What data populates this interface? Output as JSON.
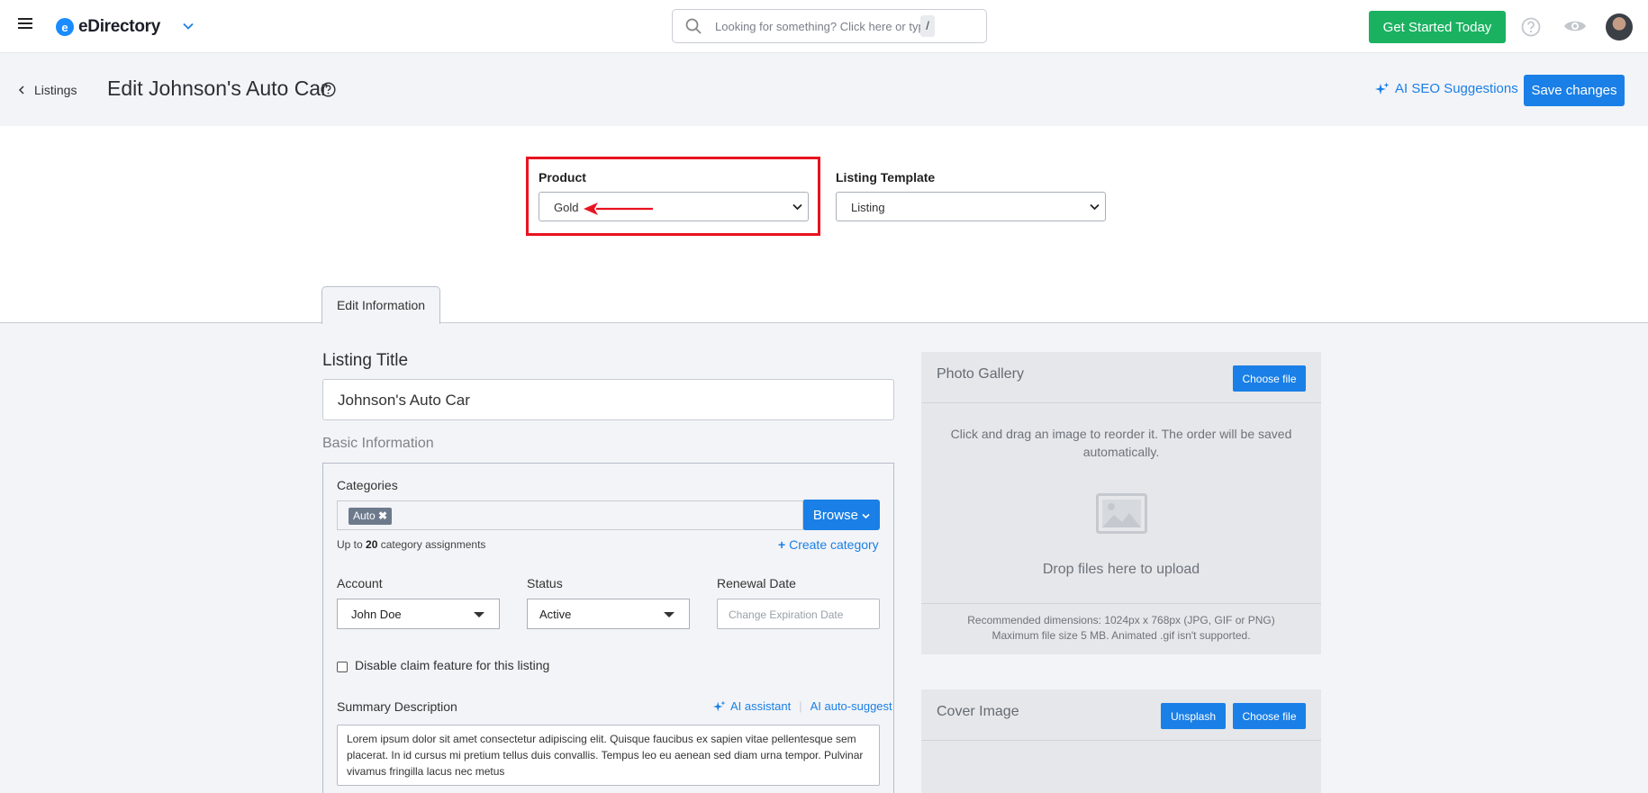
{
  "topbar": {
    "brand": "eDirectory",
    "search_placeholder": "Looking for something? Click here or type",
    "search_shortcut": "/",
    "get_started": "Get Started Today"
  },
  "header": {
    "back_label": "Listings",
    "page_title": "Edit Johnson's Auto Car",
    "ai_seo": "AI SEO Suggestions",
    "save": "Save changes"
  },
  "selects": {
    "product_label": "Product",
    "product_value": "Gold",
    "template_label": "Listing Template",
    "template_value": "Listing"
  },
  "tab": "Edit Information",
  "form": {
    "listing_title_heading": "Listing Title",
    "listing_title_value": "Johnson's Auto Car",
    "basic_info": "Basic Information",
    "categories_label": "Categories",
    "category_chip": "Auto",
    "browse": "Browse",
    "hint_prefix": "Up to ",
    "hint_count": "20",
    "hint_suffix": " category assignments",
    "create_category": "Create category",
    "account_label": "Account",
    "account_value": "John Doe",
    "status_label": "Status",
    "status_value": "Active",
    "renewal_label": "Renewal Date",
    "renewal_placeholder": "Change Expiration Date",
    "disable_claim": "Disable claim feature for this listing",
    "summary_label": "Summary Description",
    "ai_assistant": "AI assistant",
    "ai_autosuggest": "AI auto-suggest",
    "summary_text": "Lorem ipsum dolor sit amet consectetur adipiscing elit. Quisque faucibus ex sapien vitae pellentesque sem placerat. In id cursus mi pretium tellus duis convallis. Tempus leo eu aenean sed diam urna tempor. Pulvinar vivamus fringilla lacus nec metus"
  },
  "gallery": {
    "title": "Photo Gallery",
    "choose_file": "Choose file",
    "reorder_text": "Click and drag an image to reorder it. The order will be saved automatically.",
    "drop_text": "Drop files here to upload",
    "recommended": "Recommended dimensions: 1024px x 768px (JPG, GIF or PNG)",
    "max_size": "Maximum file size 5 MB. Animated .gif isn't supported."
  },
  "cover": {
    "title": "Cover Image",
    "unsplash": "Unsplash",
    "choose_file": "Choose file"
  },
  "colors": {
    "primary": "#1a7fe6",
    "success": "#1ab261",
    "highlight": "#e8131f"
  }
}
